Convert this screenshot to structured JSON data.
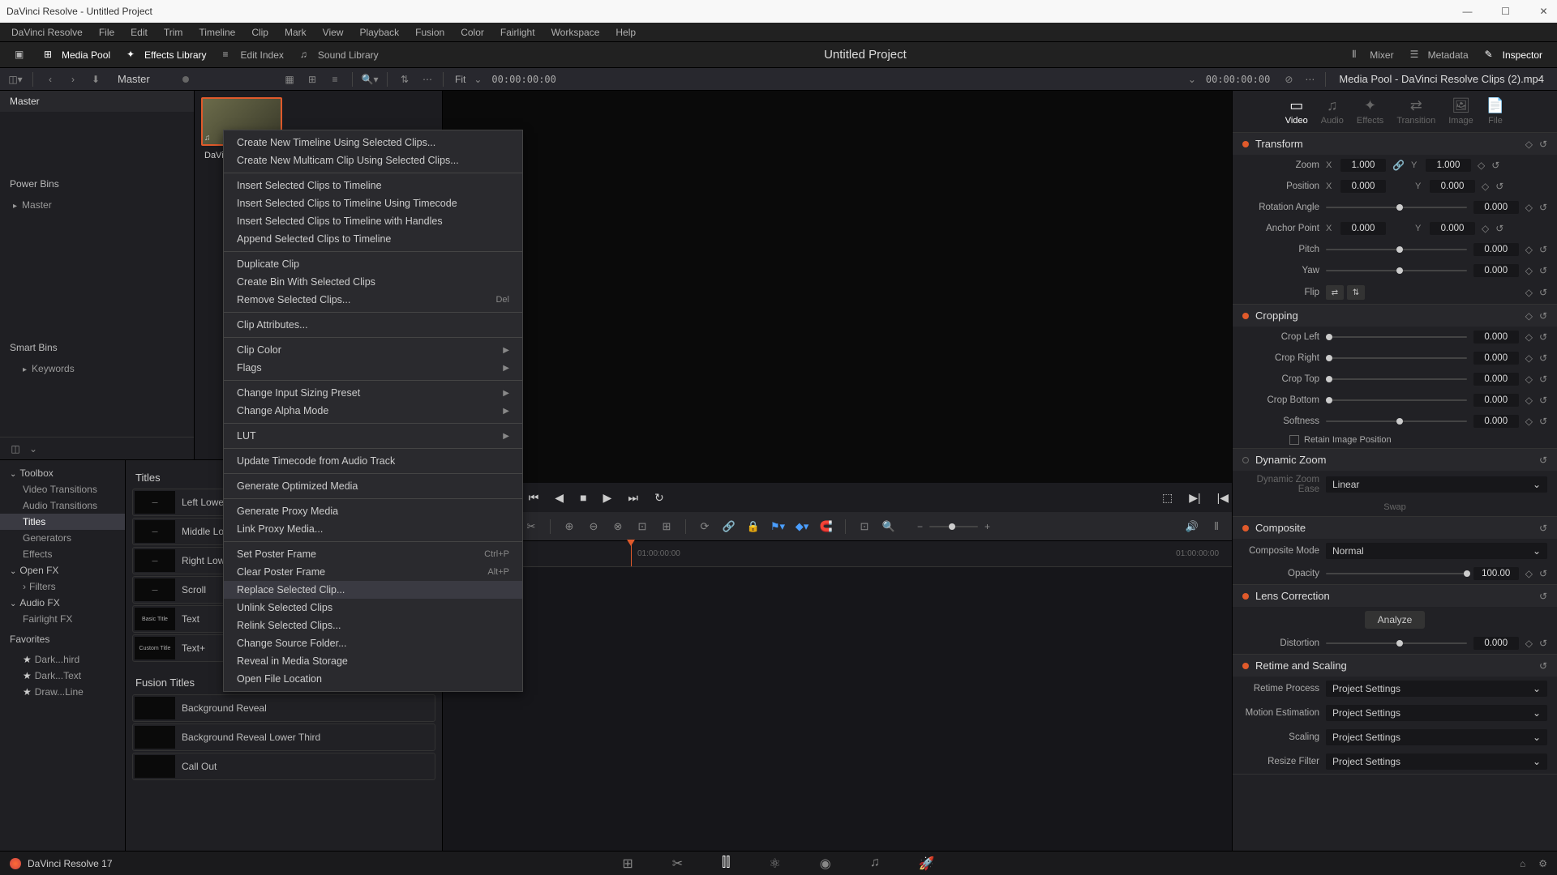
{
  "titlebar": "DaVinci Resolve - Untitled Project",
  "menubar": [
    "DaVinci Resolve",
    "File",
    "Edit",
    "Trim",
    "Timeline",
    "Clip",
    "Mark",
    "View",
    "Playback",
    "Fusion",
    "Color",
    "Fairlight",
    "Workspace",
    "Help"
  ],
  "toolbar": {
    "media_pool": "Media Pool",
    "effects_library": "Effects Library",
    "edit_index": "Edit Index",
    "sound_library": "Sound Library",
    "mixer": "Mixer",
    "metadata": "Metadata",
    "inspector": "Inspector"
  },
  "project_title": "Untitled Project",
  "secondary": {
    "master": "Master",
    "fit": "Fit",
    "tc_left": "00:00:00:00",
    "tc_right": "00:00:00:00"
  },
  "inspector_title": "Media Pool - DaVinci Resolve Clips (2).mp4",
  "bins": {
    "master": "Master",
    "power": "Power Bins",
    "power_master": "Master",
    "smart": "Smart Bins",
    "keywords": "Keywords"
  },
  "clip_name": "DaVin",
  "context_menu": [
    {
      "label": "Create New Timeline Using Selected Clips..."
    },
    {
      "label": "Create New Multicam Clip Using Selected Clips..."
    },
    {
      "sep": true
    },
    {
      "label": "Insert Selected Clips to Timeline"
    },
    {
      "label": "Insert Selected Clips to Timeline Using Timecode"
    },
    {
      "label": "Insert Selected Clips to Timeline with Handles"
    },
    {
      "label": "Append Selected Clips to Timeline"
    },
    {
      "sep": true
    },
    {
      "label": "Duplicate Clip"
    },
    {
      "label": "Create Bin With Selected Clips"
    },
    {
      "label": "Remove Selected Clips...",
      "shortcut": "Del"
    },
    {
      "sep": true
    },
    {
      "label": "Clip Attributes..."
    },
    {
      "sep": true
    },
    {
      "label": "Clip Color",
      "sub": true
    },
    {
      "label": "Flags",
      "sub": true
    },
    {
      "sep": true
    },
    {
      "label": "Change Input Sizing Preset",
      "sub": true
    },
    {
      "label": "Change Alpha Mode",
      "sub": true
    },
    {
      "sep": true
    },
    {
      "label": "LUT",
      "sub": true
    },
    {
      "sep": true
    },
    {
      "label": "Update Timecode from Audio Track"
    },
    {
      "sep": true
    },
    {
      "label": "Generate Optimized Media"
    },
    {
      "sep": true
    },
    {
      "label": "Generate Proxy Media"
    },
    {
      "label": "Link Proxy Media..."
    },
    {
      "sep": true
    },
    {
      "label": "Set Poster Frame",
      "shortcut": "Ctrl+P"
    },
    {
      "label": "Clear Poster Frame",
      "shortcut": "Alt+P"
    },
    {
      "label": "Replace Selected Clip...",
      "highlight": true
    },
    {
      "label": "Unlink Selected Clips"
    },
    {
      "label": "Relink Selected Clips..."
    },
    {
      "label": "Change Source Folder..."
    },
    {
      "label": "Reveal in Media Storage"
    },
    {
      "label": "Open File Location"
    }
  ],
  "effects_tree": [
    {
      "label": "Toolbox",
      "type": "expand"
    },
    {
      "label": "Video Transitions",
      "indent": true
    },
    {
      "label": "Audio Transitions",
      "indent": true
    },
    {
      "label": "Titles",
      "indent": true,
      "selected": true
    },
    {
      "label": "Generators",
      "indent": true
    },
    {
      "label": "Effects",
      "indent": true
    },
    {
      "label": "Open FX",
      "type": "expand"
    },
    {
      "label": "Filters",
      "indent": true,
      "collapsed": true
    },
    {
      "label": "Audio FX",
      "type": "expand"
    },
    {
      "label": "Fairlight FX",
      "indent": true
    }
  ],
  "favorites": {
    "header": "Favorites",
    "items": [
      "Dark...hird",
      "Dark...Text",
      "Draw...Line"
    ]
  },
  "titles": {
    "header": "Titles",
    "items": [
      "Left Lower",
      "Middle Lo",
      "Right Low",
      "Scroll",
      "Text",
      "Text+"
    ],
    "fusion_header": "Fusion Titles",
    "fusion_items": [
      "Background Reveal",
      "Background Reveal Lower Third",
      "Call Out"
    ]
  },
  "timeline": {
    "time": ":00:00",
    "ticks": [
      "01:00:00:00",
      "01:00:00:00"
    ]
  },
  "inspector": {
    "tabs": [
      "Video",
      "Audio",
      "Effects",
      "Transition",
      "Image",
      "File"
    ],
    "transform": {
      "title": "Transform",
      "zoom": "Zoom",
      "zoom_x": "1.000",
      "zoom_y": "1.000",
      "position": "Position",
      "pos_x": "0.000",
      "pos_y": "0.000",
      "rotation": "Rotation Angle",
      "rot_val": "0.000",
      "anchor": "Anchor Point",
      "anc_x": "0.000",
      "anc_y": "0.000",
      "pitch": "Pitch",
      "pitch_val": "0.000",
      "yaw": "Yaw",
      "yaw_val": "0.000",
      "flip": "Flip"
    },
    "cropping": {
      "title": "Cropping",
      "left": "Crop Left",
      "left_val": "0.000",
      "right": "Crop Right",
      "right_val": "0.000",
      "top": "Crop Top",
      "top_val": "0.000",
      "bottom": "Crop Bottom",
      "bottom_val": "0.000",
      "softness": "Softness",
      "soft_val": "0.000",
      "retain": "Retain Image Position"
    },
    "dynamic_zoom": {
      "title": "Dynamic Zoom",
      "ease": "Dynamic Zoom Ease",
      "ease_val": "Linear",
      "swap": "Swap"
    },
    "composite": {
      "title": "Composite",
      "mode": "Composite Mode",
      "mode_val": "Normal",
      "opacity": "Opacity",
      "opacity_val": "100.00"
    },
    "lens": {
      "title": "Lens Correction",
      "analyze": "Analyze",
      "distortion": "Distortion",
      "dist_val": "0.000"
    },
    "retime": {
      "title": "Retime and Scaling",
      "process": "Retime Process",
      "motion": "Motion Estimation",
      "scaling": "Scaling",
      "resize": "Resize Filter",
      "val": "Project Settings"
    }
  },
  "footer": {
    "version": "DaVinci Resolve 17"
  }
}
